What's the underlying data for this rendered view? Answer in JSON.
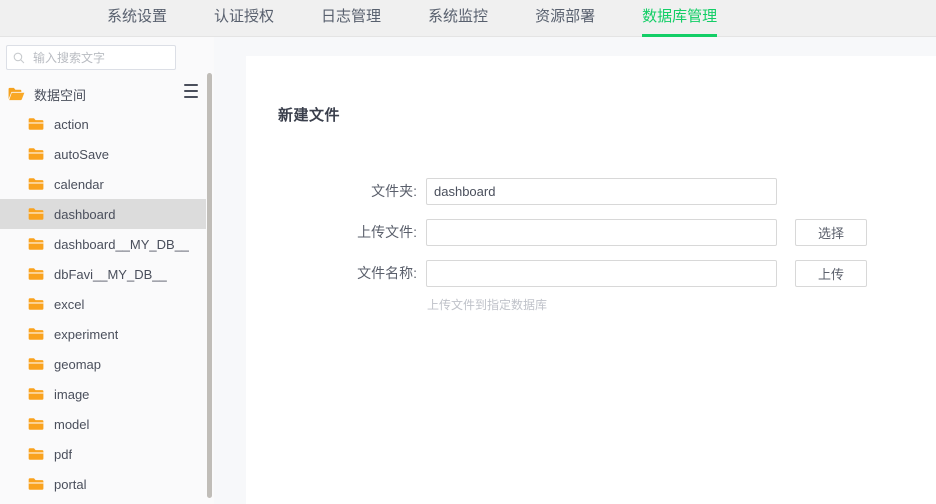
{
  "nav": {
    "items": [
      {
        "label": "系统设置",
        "active": false
      },
      {
        "label": "认证授权",
        "active": false
      },
      {
        "label": "日志管理",
        "active": false
      },
      {
        "label": "系统监控",
        "active": false
      },
      {
        "label": "资源部署",
        "active": false
      },
      {
        "label": "数据库管理",
        "active": true
      }
    ],
    "active_color": "#13ce66"
  },
  "sidebar": {
    "search": {
      "placeholder": "输入搜索文字",
      "value": ""
    },
    "menu_icon": "menu-icon",
    "root": {
      "label": "数据空间",
      "icon": "folder-open-icon"
    },
    "folder_color": "#f5a21e",
    "selected": "dashboard",
    "items": [
      {
        "label": "action"
      },
      {
        "label": "autoSave"
      },
      {
        "label": "calendar"
      },
      {
        "label": "dashboard"
      },
      {
        "label": "dashboard__MY_DB__"
      },
      {
        "label": "dbFavi__MY_DB__"
      },
      {
        "label": "excel"
      },
      {
        "label": "experiment"
      },
      {
        "label": "geomap"
      },
      {
        "label": "image"
      },
      {
        "label": "model"
      },
      {
        "label": "pdf"
      },
      {
        "label": "portal"
      }
    ]
  },
  "main": {
    "title": "新建文件",
    "fields": [
      {
        "label": "文件夹:",
        "value": "dashboard",
        "placeholder": "",
        "button": ""
      },
      {
        "label": "上传文件:",
        "value": "",
        "placeholder": "",
        "button": "选择"
      },
      {
        "label": "文件名称:",
        "value": "",
        "placeholder": "",
        "button": "上传"
      }
    ],
    "hint": "上传文件到指定数据库"
  }
}
